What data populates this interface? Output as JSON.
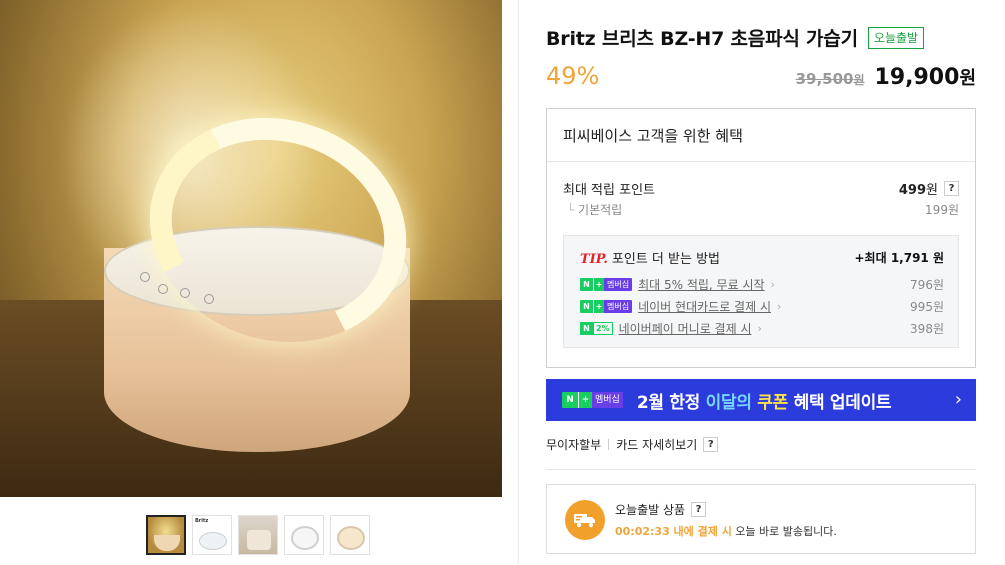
{
  "product": {
    "title": "Britz 브리츠 BZ-H7 초음파식 가습기",
    "badge": "오늘출발",
    "discount": "49%",
    "original_price": "39,500",
    "original_unit": "원",
    "sale_price": "19,900",
    "sale_unit": "원"
  },
  "gallery": {
    "thumb_brand_text": "Britz",
    "thumbnails": [
      "thumb-1",
      "thumb-2",
      "thumb-3",
      "thumb-4",
      "thumb-5"
    ],
    "active_index": 0
  },
  "benefit": {
    "heading": "피씨베이스 고객을 위한 혜택",
    "max_points_label": "최대 적립 포인트",
    "max_points_value": "499",
    "max_points_unit": "원",
    "help_mark": "?",
    "base_label": "기본적립",
    "base_value": "199원",
    "tip": {
      "tip_word": "TIP.",
      "title": "포인트 더 받는 방법",
      "max_total": "+최대 1,791 원",
      "rows": [
        {
          "badge": "nplus",
          "text": "최대 5% 적립, 무료 시작",
          "value": "796원"
        },
        {
          "badge": "nplus",
          "text": "네이버 현대카드로 결제 시",
          "value": "995원"
        },
        {
          "badge": "n2",
          "text": "네이버페이 머니로 결제 시",
          "value": "398원"
        }
      ],
      "nplus_n": "N",
      "nplus_plus": "+",
      "nplus_member": "멤버십",
      "n2_percent": "2%"
    }
  },
  "banner": {
    "part1": "2월 한정 ",
    "part2": "이달의",
    "part3": " ",
    "part4": "쿠폰",
    "part5": " 혜택 업데이트",
    "arrow": "›"
  },
  "links": {
    "installment": "무이자할부",
    "card_detail": "카드 자세히보기",
    "help_mark": "?"
  },
  "shipping": {
    "title": "오늘출발 상품",
    "help_mark": "?",
    "countdown": "00:02:33 내에 결제 시",
    "desc_rest": " 오늘 바로 발송됩니다."
  },
  "colors": {
    "accent_orange": "#f0a43a",
    "naver_green": "#19ce60",
    "banner_blue": "#2b3bdc",
    "badge_green": "#18a33d",
    "tip_red": "#e5222a"
  }
}
